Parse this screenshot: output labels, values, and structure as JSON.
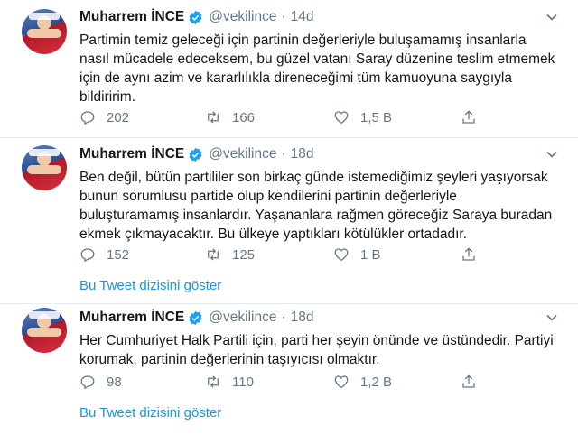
{
  "tweets": [
    {
      "name": "Muharrem İNCE",
      "handle": "@vekilince",
      "dot": "·",
      "time": "14d",
      "text": "Partimin temiz geleceği için partinin değerleriyle buluşamamış insanlarla\nnasıl mücadele edeceksem, bu güzel vatanı Saray düzenine teslim etmemek\niçin de aynı azim ve kararlılıkla direneceğimi tüm kamuoyuna saygıyla\nbildiririm.",
      "replies": "202",
      "retweets": "166",
      "likes": "1,5 B"
    },
    {
      "name": "Muharrem İNCE",
      "handle": "@vekilince",
      "dot": "·",
      "time": "18d",
      "text": "Ben değil, bütün partililer son birkaç günde istemediğimiz şeyleri yaşıyorsak\nbunun sorumlusu partide olup kendilerini partinin değerleriyle\nbuluşturamamış insanlardır. Yaşananlara rağmen göreceğiz Saraya buradan\nekmek çıkmayacaktır. Bu ülkeye yaptıkları kötülükler ortadadır.",
      "replies": "152",
      "retweets": "125",
      "likes": "1 B",
      "thread_link": "Bu Tweet dizisini göster"
    },
    {
      "name": "Muharrem İNCE",
      "handle": "@vekilince",
      "dot": "·",
      "time": "18d",
      "text": "Her Cumhuriyet Halk Partili için, parti her şeyin önünde ve üstündedir. Partiyi\nkorumak, partinin değerlerinin taşıyıcısı olmaktır.",
      "replies": "98",
      "retweets": "110",
      "likes": "1,2 B",
      "thread_link": "Bu Tweet dizisini göster"
    }
  ],
  "icons": {
    "verified": "verified-badge-icon",
    "caret": "chevron-down-icon",
    "reply": "reply-icon",
    "retweet": "retweet-icon",
    "like": "heart-icon",
    "share": "share-icon"
  },
  "colors": {
    "accent": "#1da1f2",
    "link": "#1b95e0",
    "secondary_text": "#657786",
    "separator": "#e6ecf0"
  }
}
